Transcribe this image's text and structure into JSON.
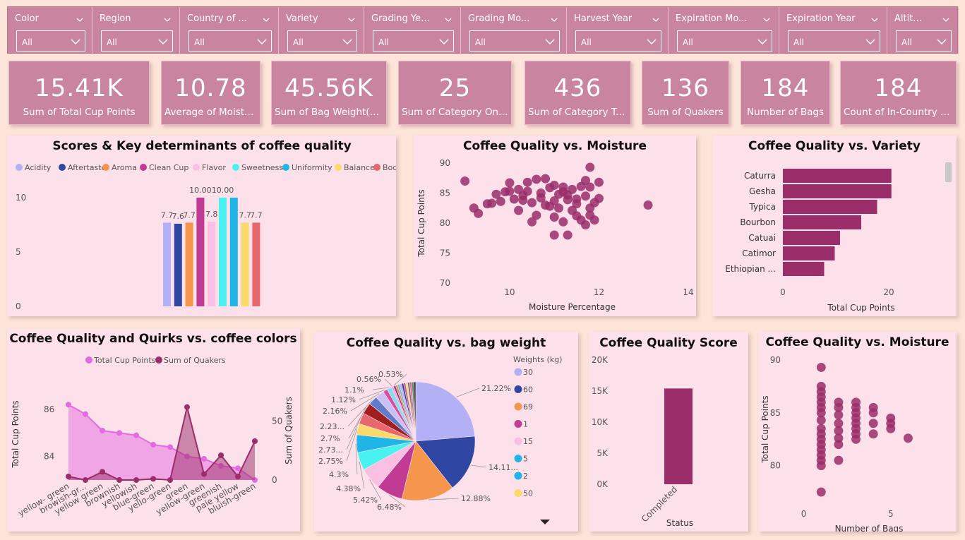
{
  "filters": [
    {
      "label": "Color",
      "value": "All"
    },
    {
      "label": "Region",
      "value": "All"
    },
    {
      "label": "Country of ...",
      "value": "All"
    },
    {
      "label": "Variety",
      "value": "All"
    },
    {
      "label": "Grading Ye...",
      "value": "All"
    },
    {
      "label": "Grading Mo...",
      "value": "All"
    },
    {
      "label": "Harvest Year",
      "value": "All"
    },
    {
      "label": "Expiration Mo...",
      "value": "All"
    },
    {
      "label": "Expiration Year",
      "value": "All"
    },
    {
      "label": "Altit...",
      "value": "All"
    }
  ],
  "kpis": [
    {
      "value": "15.41K",
      "label": "Sum of Total Cup Points"
    },
    {
      "value": "10.78",
      "label": "Average of Moistur..."
    },
    {
      "value": "45.56K",
      "label": "Sum of Bag Weight(kg)"
    },
    {
      "value": "25",
      "label": "Sum of Category One ..."
    },
    {
      "value": "436",
      "label": "Sum of Category Tw..."
    },
    {
      "value": "136",
      "label": "Sum of Quakers"
    },
    {
      "value": "184",
      "label": "Number of Bags"
    },
    {
      "value": "184",
      "label": "Count of In-Country P..."
    }
  ],
  "chart_data": [
    {
      "type": "bar",
      "title": "Scores & Key determinants of coffee quality",
      "categories": [
        "Acidity",
        "Aftertaste",
        "Aroma",
        "Clean Cup",
        "Flavor",
        "Sweetness",
        "Uniformity",
        "Balance",
        "Body"
      ],
      "values": [
        7.7,
        7.6,
        7.7,
        10.0,
        7.8,
        10.0,
        10.0,
        7.7,
        7.7
      ],
      "data_labels": [
        "7.7",
        "7.6",
        "7.7",
        "10.00",
        "7.8",
        "10.00",
        "",
        "7.7",
        "7.7"
      ],
      "colors": [
        "#b3b0f5",
        "#2f46a3",
        "#f6964c",
        "#c13b94",
        "#fbbfe4",
        "#49f1f1",
        "#1fb5e6",
        "#fcd96b",
        "#e8676c"
      ],
      "yticks": [
        0,
        5,
        10
      ],
      "ylim": [
        0,
        10
      ],
      "legend": "top"
    },
    {
      "type": "scatter",
      "title": "Coffee Quality vs. Moisture",
      "xlabel": "Moisture Percentage",
      "ylabel": "Total Cup Points",
      "xticks": [
        10,
        12,
        14
      ],
      "yticks": [
        70,
        75,
        80,
        85,
        90
      ],
      "xlim": [
        8.8,
        14
      ],
      "ylim": [
        70,
        90
      ],
      "points": [
        [
          9.0,
          87.0
        ],
        [
          9.2,
          82.5
        ],
        [
          9.3,
          81.6
        ],
        [
          9.5,
          83.2
        ],
        [
          9.6,
          83.3
        ],
        [
          9.7,
          84.8
        ],
        [
          9.8,
          83.6
        ],
        [
          9.9,
          85.2
        ],
        [
          10.0,
          86.7
        ],
        [
          10.0,
          85.3
        ],
        [
          10.1,
          84.0
        ],
        [
          10.2,
          85.6
        ],
        [
          10.2,
          82.1
        ],
        [
          10.3,
          83.8
        ],
        [
          10.3,
          84.6
        ],
        [
          10.4,
          85.3
        ],
        [
          10.4,
          86.8
        ],
        [
          10.5,
          83.4
        ],
        [
          10.5,
          80.2
        ],
        [
          10.6,
          87.3
        ],
        [
          10.6,
          81.3
        ],
        [
          10.7,
          85.0
        ],
        [
          10.7,
          84.2
        ],
        [
          10.8,
          83.0
        ],
        [
          10.8,
          87.4
        ],
        [
          10.9,
          82.8
        ],
        [
          10.9,
          85.9
        ],
        [
          11.0,
          86.3
        ],
        [
          11.0,
          83.7
        ],
        [
          11.0,
          81.0
        ],
        [
          11.1,
          84.8
        ],
        [
          11.1,
          82.5
        ],
        [
          11.2,
          86.0
        ],
        [
          11.2,
          85.2
        ],
        [
          11.2,
          80.2
        ],
        [
          11.3,
          83.9
        ],
        [
          11.3,
          84.7
        ],
        [
          11.3,
          78.0
        ],
        [
          11.4,
          82.1
        ],
        [
          11.4,
          85.6
        ],
        [
          11.5,
          83.2
        ],
        [
          11.5,
          81.2
        ],
        [
          11.5,
          84.0
        ],
        [
          11.6,
          86.1
        ],
        [
          11.6,
          80.5
        ],
        [
          11.7,
          79.7
        ],
        [
          11.7,
          84.5
        ],
        [
          11.8,
          82.5
        ],
        [
          11.8,
          81.3
        ],
        [
          11.8,
          86.0
        ],
        [
          11.8,
          89.3
        ],
        [
          11.9,
          80.5
        ],
        [
          11.9,
          83.4
        ],
        [
          12.0,
          84.1
        ],
        [
          12.0,
          86.8
        ],
        [
          11.0,
          78.0
        ],
        [
          11.7,
          87.1
        ],
        [
          13.1,
          83.0
        ]
      ],
      "color": "#9a2d6a"
    },
    {
      "type": "bar",
      "orientation": "horizontal",
      "title": "Coffee Quality vs. Variety",
      "xlabel": "Total Cup Points",
      "categories": [
        "Caturra",
        "Gesha",
        "Typica",
        "Bourbon",
        "Catuai",
        "Catimor",
        "Ethiopian ..."
      ],
      "values": [
        20.5,
        20.5,
        17.8,
        14.8,
        10.8,
        9.8,
        7.8
      ],
      "xticks": [
        0,
        20
      ],
      "xlim": [
        0,
        23
      ],
      "color": "#9a2d6a"
    },
    {
      "type": "area",
      "title": "Coffee Quality and Quirks vs. coffee colors",
      "ylabel": "Total Cup Points",
      "y2label": "Sum of Quakers",
      "categories": [
        "yellow- green",
        "browish-gr...",
        "yellow green",
        "brownish",
        "yellowish",
        "blue-green",
        "yello-green",
        "green",
        "yellow-green",
        "greenish",
        "pale yellow",
        "bluish-green"
      ],
      "series": [
        {
          "name": "Total Cup Points",
          "axis": "left",
          "values": [
            86.2,
            85.8,
            85.1,
            85.0,
            84.9,
            84.5,
            84.4,
            84.0,
            83.9,
            83.6,
            83.5,
            83.0
          ],
          "color": "#e36be0"
        },
        {
          "name": "Sum of Quakers",
          "axis": "right",
          "values": [
            3,
            0,
            7,
            0,
            0,
            1,
            0,
            62,
            5,
            21,
            3,
            33
          ],
          "color": "#9a2d6a"
        }
      ],
      "yticks": [
        84,
        86
      ],
      "y2ticks": [
        0,
        50
      ],
      "ylim": [
        83.0,
        86.6
      ],
      "y2lim": [
        0,
        72
      ],
      "legend": "top"
    },
    {
      "type": "pie",
      "title": "Coffee Quality vs. bag weight",
      "legend_title": "Weights (kg)",
      "legend": [
        {
          "label": "30",
          "color": "#b3b0f5"
        },
        {
          "label": "60",
          "color": "#2f46a3"
        },
        {
          "label": "69",
          "color": "#f6964c"
        },
        {
          "label": "1",
          "color": "#c13b94"
        },
        {
          "label": "15",
          "color": "#fbbfe4"
        },
        {
          "label": "5",
          "color": "#1fb5e6"
        },
        {
          "label": "2",
          "color": "#1fb5e6"
        },
        {
          "label": "50",
          "color": "#fcd96b"
        }
      ],
      "slices": [
        {
          "label": "21.22%",
          "value": 21.22,
          "color": "#b3b0f5"
        },
        {
          "label": "14.11...",
          "value": 14.11,
          "color": "#2f46a3"
        },
        {
          "label": "12.88%",
          "value": 12.88,
          "color": "#f6964c"
        },
        {
          "label": "6.48%",
          "value": 6.48,
          "color": "#c13b94"
        },
        {
          "label": "5.42%",
          "value": 5.42,
          "color": "#fbbfe4"
        },
        {
          "label": "4.38%",
          "value": 4.38,
          "color": "#49f1f1"
        },
        {
          "label": "4.3%",
          "value": 4.3,
          "color": "#1fb5e6"
        },
        {
          "label": "2.75%",
          "value": 2.75,
          "color": "#fcd96b"
        },
        {
          "label": "2.73...",
          "value": 2.73,
          "color": "#e8676c"
        },
        {
          "label": "2.7%",
          "value": 2.7,
          "color": "#a01e1e"
        },
        {
          "label": "2.23...",
          "value": 2.23,
          "color": "#5e7cc9"
        },
        {
          "label": "2.16%",
          "value": 2.16,
          "color": "#c9c0f5"
        },
        {
          "label": "1.12%",
          "value": 1.12,
          "color": "#d94fa0"
        },
        {
          "label": "1.1%",
          "value": 1.1,
          "color": "#7ce0f0"
        },
        {
          "label": "0.56%",
          "value": 0.56,
          "color": "#f2a6d6"
        },
        {
          "label": "0.53%",
          "value": 0.53,
          "color": "#8b3a8f"
        },
        {
          "label": "",
          "value": 0.5,
          "color": "#e98b4c"
        },
        {
          "label": "",
          "value": 0.5,
          "color": "#4ac8e0"
        },
        {
          "label": "",
          "value": 0.5,
          "color": "#cfa0f0"
        },
        {
          "label": "",
          "value": 0.5,
          "color": "#2f46a3"
        },
        {
          "label": "",
          "value": 0.5,
          "color": "#b65e8a"
        },
        {
          "label": "",
          "value": 0.5,
          "color": "#fcd96b"
        },
        {
          "label": "",
          "value": 0.5,
          "color": "#6a6aa6"
        },
        {
          "label": "",
          "value": 0.5,
          "color": "#e8676c"
        },
        {
          "label": "",
          "value": 0.5,
          "color": "#4d8c7a"
        },
        {
          "label": "",
          "value": 0.5,
          "color": "#333333"
        }
      ]
    },
    {
      "type": "bar",
      "title": "Coffee Quality Score",
      "xlabel": "Status",
      "categories": [
        "Completed"
      ],
      "values": [
        15410
      ],
      "yticks": [
        "0K",
        "5K",
        "10K",
        "15K",
        "20K"
      ],
      "ylim": [
        0,
        20000
      ],
      "color": "#9a2d6a"
    },
    {
      "type": "scatter",
      "title": "Coffee Quality vs. Moisture",
      "xlabel": "Number of Bags",
      "ylabel": "Total Cup Points",
      "xticks": [
        0,
        5
      ],
      "yticks": [
        80,
        85,
        90
      ],
      "xlim": [
        -1,
        8.5
      ],
      "ylim": [
        76.3,
        90.6
      ],
      "points": [
        [
          1,
          89.3
        ],
        [
          1,
          87.5
        ],
        [
          1,
          87.0
        ],
        [
          1,
          86.5
        ],
        [
          1,
          86.0
        ],
        [
          1,
          85.5
        ],
        [
          1,
          85.0
        ],
        [
          1,
          84.3
        ],
        [
          1,
          83.5
        ],
        [
          1,
          83.0
        ],
        [
          1,
          82.5
        ],
        [
          1,
          82.0
        ],
        [
          1,
          81.5
        ],
        [
          1,
          81.0
        ],
        [
          1,
          80.5
        ],
        [
          1,
          80.0
        ],
        [
          1,
          77.5
        ],
        [
          2,
          86.0
        ],
        [
          2,
          85.5
        ],
        [
          2,
          84.8
        ],
        [
          2,
          84.0
        ],
        [
          2,
          83.3
        ],
        [
          2,
          82.6
        ],
        [
          2,
          82.0
        ],
        [
          2,
          80.5
        ],
        [
          3,
          86.0
        ],
        [
          3,
          85.5
        ],
        [
          3,
          85.0
        ],
        [
          3,
          84.5
        ],
        [
          3,
          84.0
        ],
        [
          3,
          83.5
        ],
        [
          3,
          83.0
        ],
        [
          3,
          82.5
        ],
        [
          4,
          85.5
        ],
        [
          4,
          85.0
        ],
        [
          4,
          84.0
        ],
        [
          4,
          83.0
        ],
        [
          5,
          84.5
        ],
        [
          5,
          84.0
        ],
        [
          5,
          83.5
        ],
        [
          6,
          82.6
        ]
      ],
      "color": "#9a2d6a"
    }
  ]
}
